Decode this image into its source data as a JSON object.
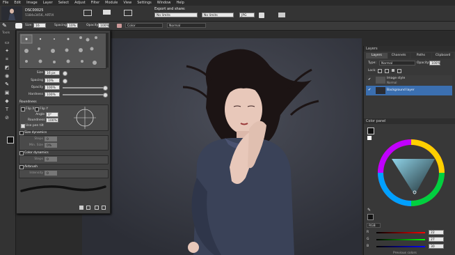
{
  "menu": [
    "File",
    "Edit",
    "Image",
    "Layer",
    "Select",
    "Adjust",
    "Filter",
    "Module",
    "View",
    "Settings",
    "Window",
    "Help"
  ],
  "document": {
    "name": "DSC00025",
    "info": "5184x3456, ARTIX"
  },
  "export": {
    "title": "Export and share:",
    "width_label": "No limits",
    "height_label": "No limits",
    "format": "JPG"
  },
  "options": {
    "size_label": "Size:",
    "size_value": "16 px",
    "spacing_label": "Spacing:",
    "spacing_value": "10%",
    "opacity_label": "Opacity:",
    "opacity_value": "100%",
    "mode_label": "Color",
    "blend": "Normal"
  },
  "brush_panel": {
    "size_label": "Size",
    "size_value": "16 px",
    "spacing_label": "Spacing",
    "spacing_value": "10%",
    "opacity_label": "Opacity",
    "opacity_value": "100%",
    "hardness_label": "Hardness",
    "hardness_value": "100%",
    "roundness_header": "Roundness",
    "flip_x": "Flip X",
    "flip_y": "Flip Y",
    "angle_label": "Angle",
    "angle_value": "0°",
    "round_label": "Roundness",
    "round_value": "100%",
    "tilt_label": "Use pen tilt",
    "size_dyn_header": "Size dynamics",
    "steps_label": "Steps",
    "steps_value": "0",
    "min_size_label": "Min. Size",
    "min_size_value": "0%",
    "color_dyn_header": "Color dynamics",
    "color_steps_label": "Steps",
    "color_steps_value": "0",
    "airbrush_header": "Airbrush",
    "intensity_label": "Intensity",
    "intensity_value": "0"
  },
  "layers": {
    "title": "Layers",
    "tabs": [
      "Layers",
      "Channels",
      "Paths",
      "Clipboard"
    ],
    "type_label": "Type:",
    "blend": "Normal",
    "opacity_label": "Opacity:",
    "opacity_value": "100%",
    "lock_label": "Lock:",
    "items": [
      {
        "name": "Image style",
        "sub": "Normal"
      },
      {
        "name": "Background layer",
        "sub": ""
      }
    ]
  },
  "color_panel": {
    "title": "Color panel",
    "model": "RGB",
    "r_label": "R",
    "r_value": "22",
    "g_label": "G",
    "g_value": "27",
    "b_label": "B",
    "b_value": "30",
    "previous_label": "Previous colors"
  },
  "colors": {
    "accent": "#3a7bd5",
    "selection": "#3b6fb0"
  }
}
